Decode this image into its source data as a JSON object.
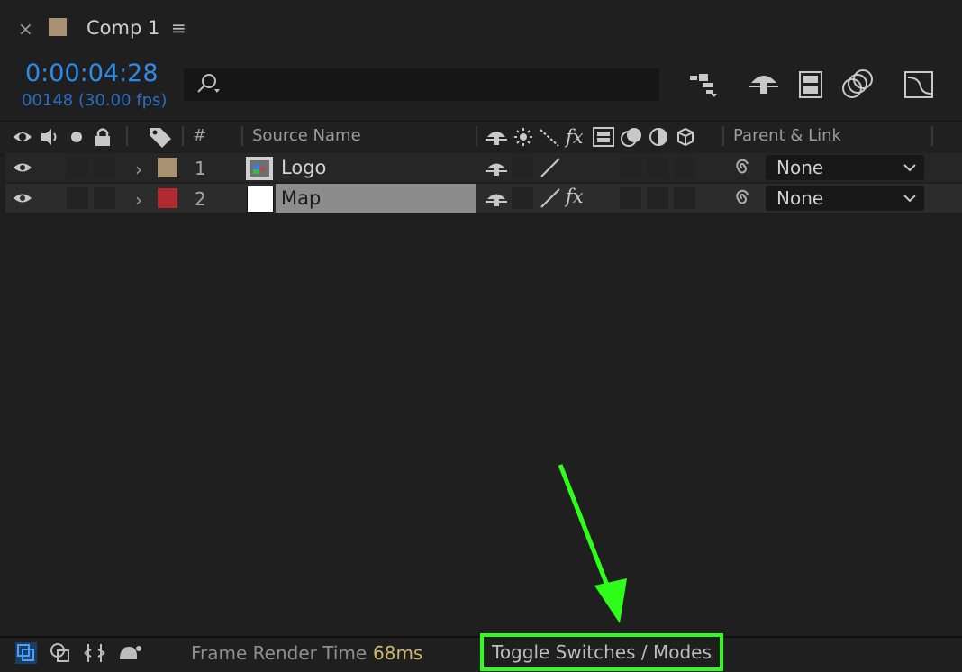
{
  "tab": {
    "close_glyph": "×",
    "title": "Comp 1",
    "menu_glyph": "≡",
    "swatch_color": "#a89272"
  },
  "time": {
    "timecode": "0:00:04:28",
    "frames": "00148 (30.00 fps)",
    "timecode_color": "#2d8ceb"
  },
  "search": {
    "value": "",
    "placeholder": ""
  },
  "toolbar": {
    "icons": [
      "composition-flowchart-icon",
      "draft-3d-icon",
      "frame-blending-icon",
      "motion-blur-icon",
      "graph-editor-icon"
    ]
  },
  "columns": {
    "number": "#",
    "source_name": "Source Name",
    "parent_link": "Parent & Link",
    "fx": "fx"
  },
  "layers": [
    {
      "number": "1",
      "name": "Logo",
      "label_color": "#a89272",
      "parent": "None",
      "fx": ""
    },
    {
      "number": "2",
      "name": "Map",
      "label_color": "#b12a30",
      "parent": "None",
      "fx": "fx"
    }
  ],
  "status": {
    "render_label": "Frame Render Time",
    "render_value": "68ms",
    "toggle_label": "Toggle Switches / Modes",
    "highlight_color": "#2dff1a"
  }
}
